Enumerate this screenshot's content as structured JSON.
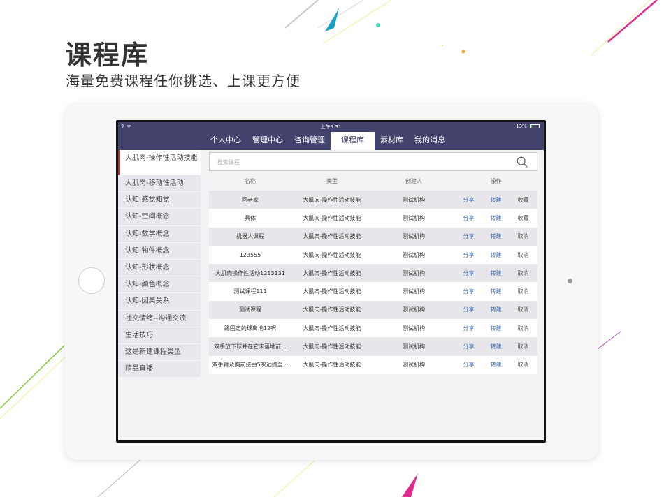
{
  "headline": "课程库",
  "subheadline": "海量免费课程任你挑选、上课更方便",
  "colors": {
    "nav_bg": "#42426d",
    "active_marker": "#c62828",
    "link": "#3f6eb8"
  },
  "status_bar": {
    "left_icons": "✈ ᯤ",
    "time": "上午9:31",
    "battery": "13%"
  },
  "nav": {
    "tabs": [
      {
        "label": "个人中心"
      },
      {
        "label": "管理中心"
      },
      {
        "label": "咨询管理"
      },
      {
        "label": "课程库"
      },
      {
        "label": "素材库"
      },
      {
        "label": "我的消息"
      }
    ],
    "active_tab": "课程库"
  },
  "sidebar": {
    "items": [
      {
        "label": "大肌肉-操作性活动技能"
      },
      {
        "label": "大肌肉-移动性活动"
      },
      {
        "label": "认知-感觉知觉"
      },
      {
        "label": "认知-空间概念"
      },
      {
        "label": "认知-数学概念"
      },
      {
        "label": "认知-物件概念"
      },
      {
        "label": "认知-形状概念"
      },
      {
        "label": "认知-颜色概念"
      },
      {
        "label": "认知-因果关系"
      },
      {
        "label": "社交情绪--沟通交流"
      },
      {
        "label": "生活技巧"
      },
      {
        "label": "这是新建课程类型"
      },
      {
        "label": "精品直播"
      }
    ],
    "active_index": 0
  },
  "search": {
    "placeholder": "搜索课程",
    "icon": "search-icon"
  },
  "table": {
    "headers": {
      "name": "名称",
      "type": "类型",
      "creator": "创建人",
      "ops": "操作"
    },
    "rows": [
      {
        "name": "回老家",
        "type": "大肌肉-操作性活动技能",
        "creator": "测试机构",
        "share": "分享",
        "convert": "转建",
        "collect": "收藏"
      },
      {
        "name": "具体",
        "type": "大肌肉-操作性活动技能",
        "creator": "测试机构",
        "share": "分享",
        "convert": "转建",
        "collect": "收藏"
      },
      {
        "name": "机器人课程",
        "type": "大肌肉-操作性活动技能",
        "creator": "测试机构",
        "share": "分享",
        "convert": "转建",
        "collect": "取消"
      },
      {
        "name": "123555",
        "type": "大肌肉-操作性活动技能",
        "creator": "测试机构",
        "share": "分享",
        "convert": "转建",
        "collect": "取消"
      },
      {
        "name": "大肌肉操作性活动1213131",
        "type": "大肌肉-操作性活动技能",
        "creator": "测试机构",
        "share": "分享",
        "convert": "转建",
        "collect": "取消"
      },
      {
        "name": "测试课程111",
        "type": "大肌肉-操作性活动技能",
        "creator": "测试机构",
        "share": "分享",
        "convert": "转建",
        "collect": "取消"
      },
      {
        "name": "测试课程",
        "type": "大肌肉-操作性活动技能",
        "creator": "测试机构",
        "share": "分享",
        "convert": "转建",
        "collect": "取消"
      },
      {
        "name": "踢固定的球离地12呎",
        "type": "大肌肉-操作性活动技能",
        "creator": "测试机构",
        "share": "分享",
        "convert": "转建",
        "collect": "取消"
      },
      {
        "name": "双手放下球并在它未落地前...",
        "type": "大肌肉-操作性活动技能",
        "creator": "测试机构",
        "share": "分享",
        "convert": "转建",
        "collect": "取消"
      },
      {
        "name": "双手臂及胸前接由5呎远抛至...",
        "type": "大肌肉-操作性活动技能",
        "creator": "测试机构",
        "share": "分享",
        "convert": "转建",
        "collect": "取消"
      }
    ]
  }
}
